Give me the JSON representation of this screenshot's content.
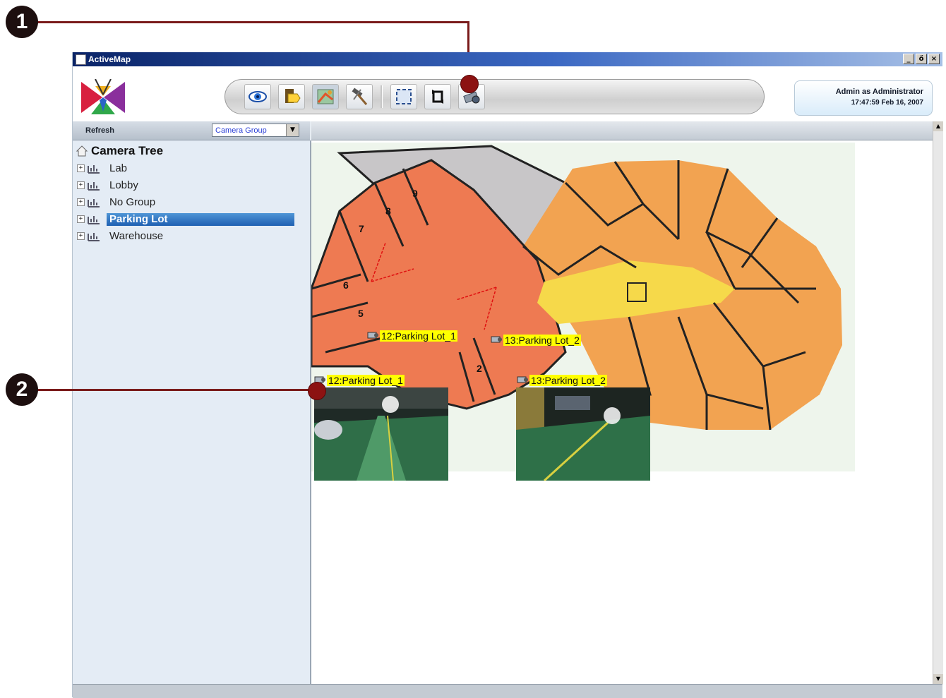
{
  "window": {
    "title": "ActiveMap",
    "controls": {
      "minimize": "_",
      "restore": "ő",
      "close": "×"
    }
  },
  "callouts": [
    "1",
    "2"
  ],
  "toolbar": {
    "buttons": [
      "eye-icon",
      "tag-icon",
      "map-tool-icon",
      "hammer-icon",
      "fit-screen-icon",
      "rotate-icon",
      "camera-device-icon"
    ]
  },
  "user": {
    "line1": "Admin as Administrator",
    "line2": "17:47:59 Feb 16, 2007"
  },
  "left_panel": {
    "refresh_label": "Refresh",
    "group_select": "Camera Group",
    "tree_root": "Camera Tree",
    "groups": [
      {
        "label": "Lab",
        "selected": false
      },
      {
        "label": "Lobby",
        "selected": false
      },
      {
        "label": "No Group",
        "selected": false
      },
      {
        "label": "Parking Lot",
        "selected": true
      },
      {
        "label": "Warehouse",
        "selected": false
      }
    ]
  },
  "map": {
    "room_numbers": [
      "9",
      "8",
      "7",
      "6",
      "5",
      "2"
    ],
    "cameras": [
      {
        "label": "12:Parking Lot_1"
      },
      {
        "label": "13:Parking Lot_2"
      }
    ],
    "feed_labels": [
      "12:Parking Lot_1",
      "13:Parking Lot_2"
    ]
  },
  "colors": {
    "parking_red": "#ee7a52",
    "building_orange": "#f2a351",
    "corridor_yellow": "#f6d94a",
    "label_yellow": "#ffff00",
    "selection_blue": "#2a6dbd"
  }
}
